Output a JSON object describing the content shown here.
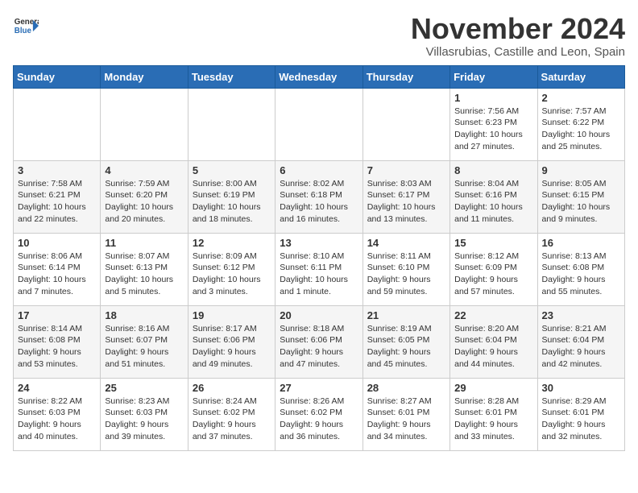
{
  "header": {
    "logo_line1": "General",
    "logo_line2": "Blue",
    "month": "November 2024",
    "location": "Villasrubias, Castille and Leon, Spain"
  },
  "weekdays": [
    "Sunday",
    "Monday",
    "Tuesday",
    "Wednesday",
    "Thursday",
    "Friday",
    "Saturday"
  ],
  "weeks": [
    [
      {
        "day": "",
        "info": ""
      },
      {
        "day": "",
        "info": ""
      },
      {
        "day": "",
        "info": ""
      },
      {
        "day": "",
        "info": ""
      },
      {
        "day": "",
        "info": ""
      },
      {
        "day": "1",
        "info": "Sunrise: 7:56 AM\nSunset: 6:23 PM\nDaylight: 10 hours\nand 27 minutes."
      },
      {
        "day": "2",
        "info": "Sunrise: 7:57 AM\nSunset: 6:22 PM\nDaylight: 10 hours\nand 25 minutes."
      }
    ],
    [
      {
        "day": "3",
        "info": "Sunrise: 7:58 AM\nSunset: 6:21 PM\nDaylight: 10 hours\nand 22 minutes."
      },
      {
        "day": "4",
        "info": "Sunrise: 7:59 AM\nSunset: 6:20 PM\nDaylight: 10 hours\nand 20 minutes."
      },
      {
        "day": "5",
        "info": "Sunrise: 8:00 AM\nSunset: 6:19 PM\nDaylight: 10 hours\nand 18 minutes."
      },
      {
        "day": "6",
        "info": "Sunrise: 8:02 AM\nSunset: 6:18 PM\nDaylight: 10 hours\nand 16 minutes."
      },
      {
        "day": "7",
        "info": "Sunrise: 8:03 AM\nSunset: 6:17 PM\nDaylight: 10 hours\nand 13 minutes."
      },
      {
        "day": "8",
        "info": "Sunrise: 8:04 AM\nSunset: 6:16 PM\nDaylight: 10 hours\nand 11 minutes."
      },
      {
        "day": "9",
        "info": "Sunrise: 8:05 AM\nSunset: 6:15 PM\nDaylight: 10 hours\nand 9 minutes."
      }
    ],
    [
      {
        "day": "10",
        "info": "Sunrise: 8:06 AM\nSunset: 6:14 PM\nDaylight: 10 hours\nand 7 minutes."
      },
      {
        "day": "11",
        "info": "Sunrise: 8:07 AM\nSunset: 6:13 PM\nDaylight: 10 hours\nand 5 minutes."
      },
      {
        "day": "12",
        "info": "Sunrise: 8:09 AM\nSunset: 6:12 PM\nDaylight: 10 hours\nand 3 minutes."
      },
      {
        "day": "13",
        "info": "Sunrise: 8:10 AM\nSunset: 6:11 PM\nDaylight: 10 hours\nand 1 minute."
      },
      {
        "day": "14",
        "info": "Sunrise: 8:11 AM\nSunset: 6:10 PM\nDaylight: 9 hours\nand 59 minutes."
      },
      {
        "day": "15",
        "info": "Sunrise: 8:12 AM\nSunset: 6:09 PM\nDaylight: 9 hours\nand 57 minutes."
      },
      {
        "day": "16",
        "info": "Sunrise: 8:13 AM\nSunset: 6:08 PM\nDaylight: 9 hours\nand 55 minutes."
      }
    ],
    [
      {
        "day": "17",
        "info": "Sunrise: 8:14 AM\nSunset: 6:08 PM\nDaylight: 9 hours\nand 53 minutes."
      },
      {
        "day": "18",
        "info": "Sunrise: 8:16 AM\nSunset: 6:07 PM\nDaylight: 9 hours\nand 51 minutes."
      },
      {
        "day": "19",
        "info": "Sunrise: 8:17 AM\nSunset: 6:06 PM\nDaylight: 9 hours\nand 49 minutes."
      },
      {
        "day": "20",
        "info": "Sunrise: 8:18 AM\nSunset: 6:06 PM\nDaylight: 9 hours\nand 47 minutes."
      },
      {
        "day": "21",
        "info": "Sunrise: 8:19 AM\nSunset: 6:05 PM\nDaylight: 9 hours\nand 45 minutes."
      },
      {
        "day": "22",
        "info": "Sunrise: 8:20 AM\nSunset: 6:04 PM\nDaylight: 9 hours\nand 44 minutes."
      },
      {
        "day": "23",
        "info": "Sunrise: 8:21 AM\nSunset: 6:04 PM\nDaylight: 9 hours\nand 42 minutes."
      }
    ],
    [
      {
        "day": "24",
        "info": "Sunrise: 8:22 AM\nSunset: 6:03 PM\nDaylight: 9 hours\nand 40 minutes."
      },
      {
        "day": "25",
        "info": "Sunrise: 8:23 AM\nSunset: 6:03 PM\nDaylight: 9 hours\nand 39 minutes."
      },
      {
        "day": "26",
        "info": "Sunrise: 8:24 AM\nSunset: 6:02 PM\nDaylight: 9 hours\nand 37 minutes."
      },
      {
        "day": "27",
        "info": "Sunrise: 8:26 AM\nSunset: 6:02 PM\nDaylight: 9 hours\nand 36 minutes."
      },
      {
        "day": "28",
        "info": "Sunrise: 8:27 AM\nSunset: 6:01 PM\nDaylight: 9 hours\nand 34 minutes."
      },
      {
        "day": "29",
        "info": "Sunrise: 8:28 AM\nSunset: 6:01 PM\nDaylight: 9 hours\nand 33 minutes."
      },
      {
        "day": "30",
        "info": "Sunrise: 8:29 AM\nSunset: 6:01 PM\nDaylight: 9 hours\nand 32 minutes."
      }
    ]
  ]
}
